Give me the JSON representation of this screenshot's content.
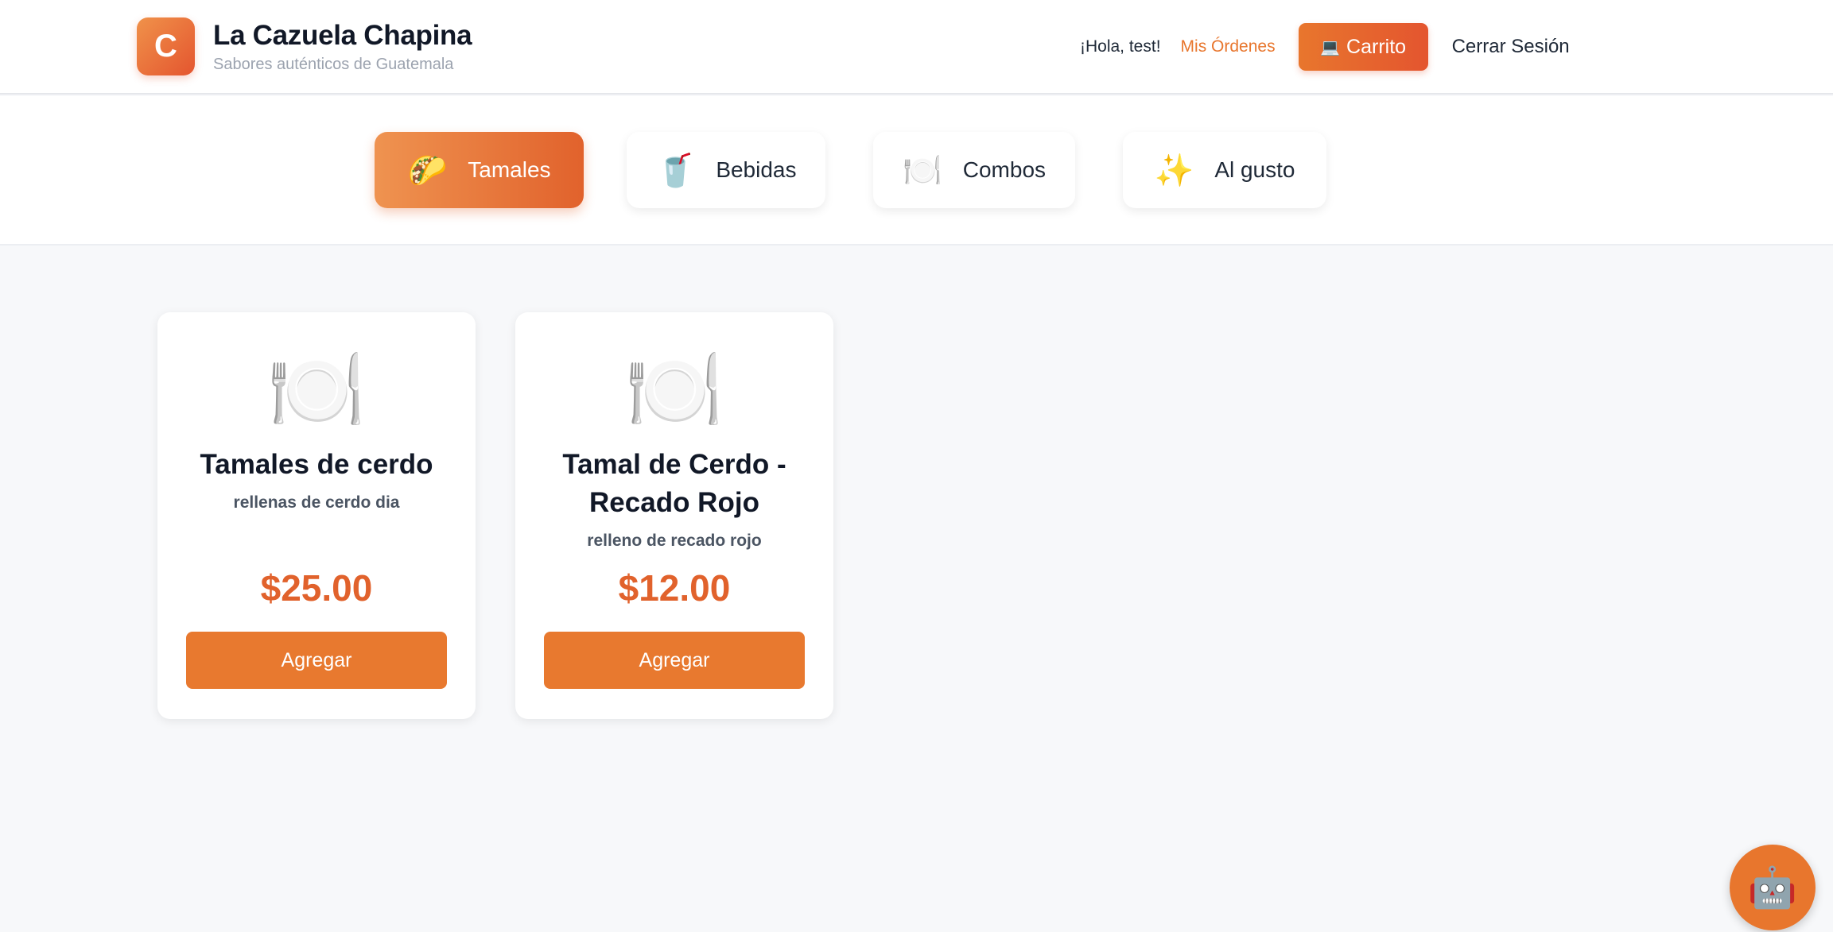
{
  "brand": {
    "logo_letter": "C",
    "title": "La Cazuela Chapina",
    "subtitle": "Sabores auténticos de Guatemala"
  },
  "nav": {
    "greeting": "¡Hola, test!",
    "orders": "Mis Órdenes",
    "cart": "Carrito",
    "cart_icon": "💻",
    "logout": "Cerrar Sesión"
  },
  "categories": [
    {
      "label": "Tamales",
      "icon": "🌮",
      "icon_name": "tamal-icon",
      "active": true
    },
    {
      "label": "Bebidas",
      "icon": "🥤",
      "icon_name": "cup-icon",
      "active": false
    },
    {
      "label": "Combos",
      "icon": "🍽️",
      "icon_name": "plate-icon",
      "active": false
    },
    {
      "label": "Al gusto",
      "icon": "✨",
      "icon_name": "sparkles-icon",
      "active": false
    }
  ],
  "products": [
    {
      "icon": "🍽️",
      "title": "Tamales de cerdo",
      "description": "rellenas de cerdo dia",
      "price": "$25.00",
      "button": "Agregar"
    },
    {
      "icon": "🍽️",
      "title": "Tamal de Cerdo - Recado Rojo",
      "description": "relleno de recado rojo",
      "price": "$12.00",
      "button": "Agregar"
    }
  ],
  "chatbot": {
    "icon": "🤖"
  },
  "colors": {
    "accent": "#e8762d",
    "accent_dark": "#e4552f",
    "background": "#f7f8fa"
  }
}
